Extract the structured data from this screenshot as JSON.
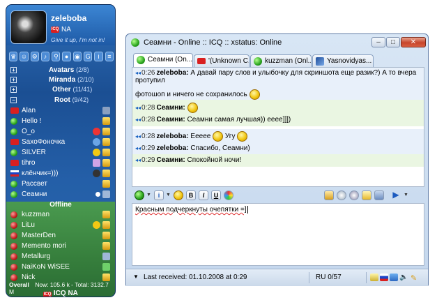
{
  "contact_list": {
    "nick": "zeleboba",
    "status": "NA",
    "mood": "Give it up, I'm not in!",
    "groups": [
      {
        "name": "Avatars",
        "count": "(2/8)"
      },
      {
        "name": "Miranda",
        "count": "(2/10)"
      },
      {
        "name": "Other",
        "count": "(11/41)"
      },
      {
        "name": "Root",
        "count": "(9/42)"
      }
    ],
    "online_contacts": [
      "Alan",
      "Hello !",
      "O_o",
      "SaxoФоночка",
      "SILVER",
      "tihro",
      "клёнчик=)))",
      "Рассвет",
      "Сеамни"
    ],
    "offline_label": "Offline",
    "offline_contacts": [
      "kuzzman",
      "LiLu",
      "MasterDen",
      "Memento mori",
      "Metallurg",
      "NaiKoN WiSEE",
      "Nick"
    ],
    "footer_overall": "Overall",
    "footer_traffic": "Now: 105.6 k - Total: 3132.7 M",
    "footer_status": "ICQ NA"
  },
  "chat": {
    "title": "Сеамни - Online :: ICQ                         :: xstatus: Online",
    "tabs": [
      {
        "label": "Сеамни (On..."
      },
      {
        "label": "'(Unknown C..."
      },
      {
        "label": "kuzzman (Onl..."
      },
      {
        "label": "Yasnovidyas..."
      }
    ],
    "messages": [
      {
        "time": "0:26",
        "who": "zeleboba:",
        "text": "А давай пару слов и улыбочку для скриншота еще разик?) А то вчера протупил",
        "text2": "фотошоп и ничего не сохранилось"
      },
      {
        "time": "0:28",
        "who": "Сеамни:",
        "text": ""
      },
      {
        "time": "0:28",
        "who": "Сеамни:",
        "text": "Сеамни самая лучшая)) ееее]]])"
      },
      {
        "time": "0:28",
        "who": "zeleboba:",
        "text": "Еееее",
        "text2": "Угу"
      },
      {
        "time": "0:29",
        "who": "zeleboba:",
        "text": "Спасибо, Сеамни)"
      },
      {
        "time": "0:29",
        "who": "Сеамни:",
        "text": "Спокойной ночи!"
      }
    ],
    "input_text": "Красным подчеркнуты очепятки =]",
    "last_received": "Last received: 01.10.2008 at 0:29",
    "char_count": "RU 0/57"
  }
}
